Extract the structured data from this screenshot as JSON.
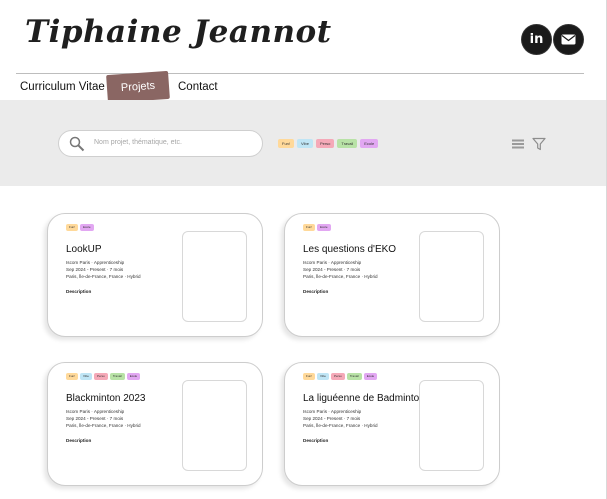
{
  "brand": "Tiphaine Jeannot",
  "social": {
    "linkedin_label": "in"
  },
  "nav": {
    "cv": "Curriculum Vitae",
    "projets": "Projets",
    "contact": "Contact"
  },
  "search": {
    "placeholder": "Nom projet, thématique, etc."
  },
  "filters": [
    "Fun!",
    "Vibe",
    "Perso",
    "Travail",
    "Ecole"
  ],
  "cards": [
    {
      "title": "LookUP",
      "tags": [
        "Fun!",
        "Ecole"
      ],
      "org": "Iscom Paris · Apprenticeship",
      "period": "Sep 2024 - Present · 7 mois",
      "location": "Paris, Île-de-France, France · Hybrid",
      "desc": "Description"
    },
    {
      "title": "Les questions d'EKO",
      "tags": [
        "Fun!",
        "Ecole"
      ],
      "org": "Iscom Paris · Apprenticeship",
      "period": "Sep 2024 - Present · 7 mois",
      "location": "Paris, Île-de-France, France · Hybrid",
      "desc": "Description"
    },
    {
      "title": "Blackminton 2023",
      "tags": [
        "Fun!",
        "Vibe",
        "Perso",
        "Travail",
        "Ecole"
      ],
      "org": "Iscom Paris · Apprenticeship",
      "period": "Sep 2024 - Present · 7 mois",
      "location": "Paris, Île-de-France, France · Hybrid",
      "desc": "Description"
    },
    {
      "title": "La liguéenne de Badminton",
      "tags": [
        "Fun!",
        "Vibe",
        "Perso",
        "Travail",
        "Ecole"
      ],
      "org": "Iscom Paris · Apprenticeship",
      "period": "Sep 2024 - Present · 7 mois",
      "location": "Paris, Île-de-France, France · Hybrid",
      "desc": "Description"
    }
  ],
  "colors": {
    "accent": "#8a6663",
    "band": "#ebebeb",
    "tag_fun": "#ffd99a",
    "tag_vibe": "#bfe5f5",
    "tag_perso": "#f5a9b8",
    "tag_travail": "#b8e2a6",
    "tag_ecole": "#e2a7f2"
  },
  "icons": {
    "search": "magnifier-icon",
    "list": "list-view-icon",
    "filter": "funnel-icon",
    "linkedin": "linkedin-icon",
    "mail": "mail-icon"
  }
}
